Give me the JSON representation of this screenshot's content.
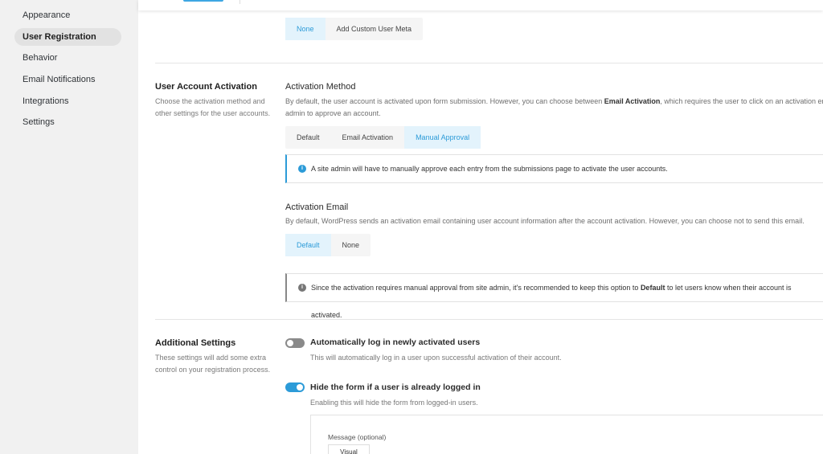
{
  "sidebar": {
    "items": [
      {
        "label": "Appearance",
        "active": false
      },
      {
        "label": "User Registration",
        "active": true
      },
      {
        "label": "Behavior",
        "active": false
      },
      {
        "label": "Email Notifications",
        "active": false
      },
      {
        "label": "Integrations",
        "active": false
      },
      {
        "label": "Settings",
        "active": false
      }
    ]
  },
  "user_meta": {
    "options": [
      "None",
      "Add Custom User Meta"
    ],
    "selected": "None"
  },
  "user_account_activation": {
    "title": "User Account Activation",
    "description": "Choose the activation method and other settings for the user accounts.",
    "activation_method": {
      "title": "Activation Method",
      "description_pre": "By default, the user account is activated upon form submission. However, you can choose between ",
      "description_bold": "Email Activation",
      "description_post": ", which requires the user to click on an activation email, or",
      "description_line2": "admin to approve an account.",
      "options": [
        "Default",
        "Email Activation",
        "Manual Approval"
      ],
      "selected": "Manual Approval",
      "notice": "A site admin will have to manually approve each entry from the submissions page to activate the user accounts."
    },
    "activation_email": {
      "title": "Activation Email",
      "description": "By default, WordPress sends an activation email containing user account information after the account activation. However, you can choose not to send this email.",
      "options": [
        "Default",
        "None"
      ],
      "selected": "Default",
      "notice_pre": "Since the activation requires manual approval from site admin, it's recommended to keep this option to ",
      "notice_bold": "Default",
      "notice_post": " to let users know when their account is activated."
    }
  },
  "additional_settings": {
    "title": "Additional Settings",
    "description": "These settings will add some extra control on your registration process.",
    "toggles": [
      {
        "label": "Automatically log in newly activated users",
        "description": "This will automatically log in a user upon successful activation of their account.",
        "on": false
      },
      {
        "label": "Hide the form if a user is already logged in",
        "description": "Enabling this will hide the form from logged-in users.",
        "on": true
      }
    ],
    "message_label": "Message (optional)",
    "editor_tab": "Visual"
  },
  "colors": {
    "accent": "#2c9bd8",
    "selected_bg": "#e3f3fc",
    "sidebar_bg": "#f1f1f1"
  }
}
